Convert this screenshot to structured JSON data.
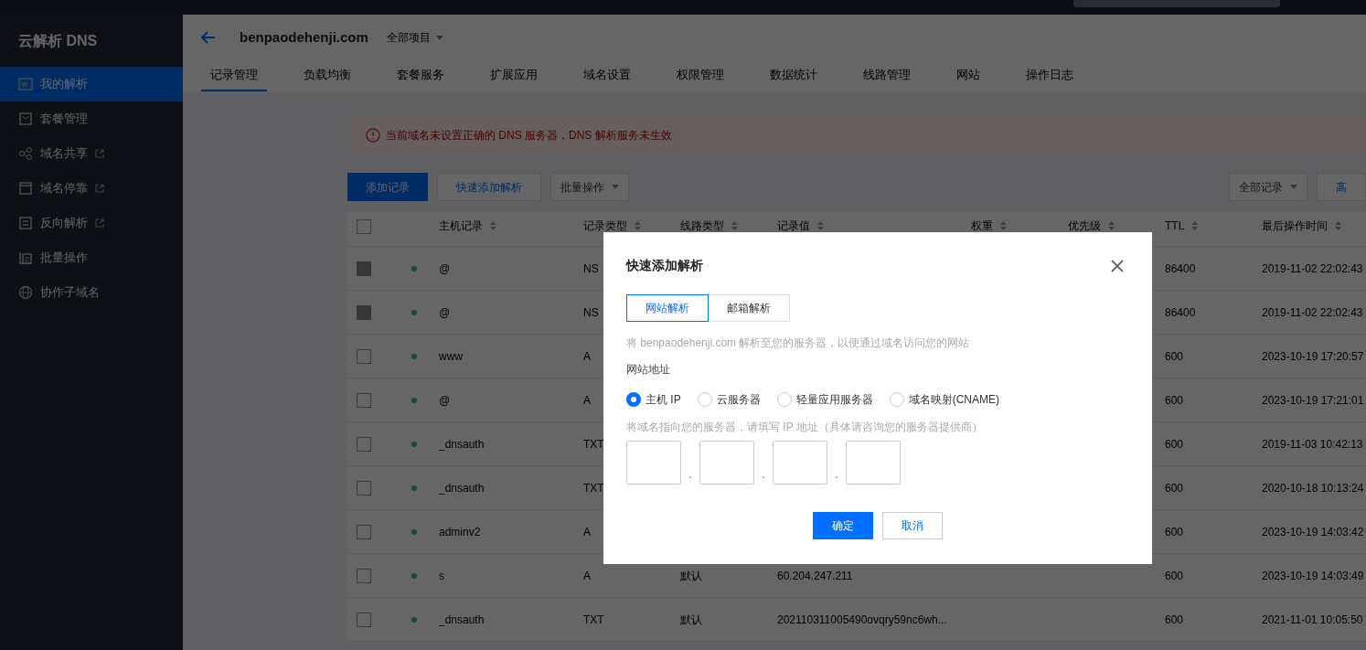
{
  "app": {
    "title": "云解析 DNS"
  },
  "sidebar": {
    "items": [
      {
        "label": "我的解析",
        "selected": true,
        "external": false
      },
      {
        "label": "套餐管理",
        "selected": false,
        "external": false
      },
      {
        "label": "域名共享",
        "selected": false,
        "external": true
      },
      {
        "label": "域名停靠",
        "selected": false,
        "external": true
      },
      {
        "label": "反向解析",
        "selected": false,
        "external": true
      },
      {
        "label": "批量操作",
        "selected": false,
        "external": false
      },
      {
        "label": "协作子域名",
        "selected": false,
        "external": false
      }
    ]
  },
  "header": {
    "domain": "benpaodehenji.com",
    "project": "全部项目"
  },
  "tabs": [
    {
      "label": "记录管理",
      "selected": true
    },
    {
      "label": "负载均衡",
      "selected": false
    },
    {
      "label": "套餐服务",
      "selected": false
    },
    {
      "label": "扩展应用",
      "selected": false
    },
    {
      "label": "域名设置",
      "selected": false
    },
    {
      "label": "权限管理",
      "selected": false
    },
    {
      "label": "数据统计",
      "selected": false
    },
    {
      "label": "线路管理",
      "selected": false
    },
    {
      "label": "网站",
      "selected": false
    },
    {
      "label": "操作日志",
      "selected": false
    }
  ],
  "alert": {
    "text": "当前域名未设置正确的 DNS 服务器，DNS 解析服务未生效"
  },
  "toolbar": {
    "left": [
      {
        "label": "添加记录",
        "kind": "primary"
      },
      {
        "label": "快速添加解析",
        "kind": "link"
      },
      {
        "label": "批量操作",
        "kind": "dropdown"
      }
    ],
    "right": [
      {
        "label": "全部记录",
        "kind": "dropdown"
      },
      {
        "label": "高",
        "kind": "link"
      }
    ]
  },
  "table": {
    "columns": [
      "主机记录",
      "记录类型",
      "线路类型",
      "记录值",
      "权重",
      "优先级",
      "TTL",
      "最后操作时间"
    ],
    "select_all": {
      "checked": false
    },
    "rows": [
      {
        "disabled": true,
        "host": "@",
        "type": "NS",
        "ttl": "86400",
        "time": "2019-11-02 22:02:43"
      },
      {
        "disabled": true,
        "host": "@",
        "type": "NS",
        "ttl": "86400",
        "time": "2019-11-02 22:02:43"
      },
      {
        "disabled": false,
        "host": "www",
        "type": "A",
        "ttl": "600",
        "time": "2023-10-19 17:20:57"
      },
      {
        "disabled": false,
        "host": "@",
        "type": "A",
        "ttl": "600",
        "time": "2023-10-19 17:21:01"
      },
      {
        "disabled": false,
        "host": "_dnsauth",
        "type": "TXT",
        "ttl": "600",
        "time": "2019-11-03 10:42:13"
      },
      {
        "disabled": false,
        "host": "_dnsauth",
        "type": "TXT",
        "ttl": "600",
        "time": "2020-10-18 10:13:24"
      },
      {
        "disabled": false,
        "host": "adminv2",
        "type": "A",
        "ttl": "600",
        "time": "2023-10-19 14:03:42"
      },
      {
        "disabled": false,
        "host": "s",
        "type": "A",
        "line": "默认",
        "value": "60.204.247.211",
        "ttl": "600",
        "time": "2023-10-19 14:03:49"
      },
      {
        "disabled": false,
        "host": "_dnsauth",
        "type": "TXT",
        "line": "默认",
        "value": "202110311005490ovqry59nc6wh...",
        "ttl": "600",
        "time": "2021-11-01 10:05:50"
      }
    ]
  },
  "dialog": {
    "title": "快速添加解析",
    "tabs": [
      {
        "label": "网站解析",
        "selected": true
      },
      {
        "label": "邮箱解析",
        "selected": false
      }
    ],
    "description": "将 benpaodehenji.com 解析至您的服务器，以便通过域名访问您的网站",
    "field_label": "网站地址",
    "options": [
      {
        "label": "主机 IP",
        "selected": true
      },
      {
        "label": "云服务器",
        "selected": false
      },
      {
        "label": "轻量应用服务器",
        "selected": false
      },
      {
        "label": "域名映射(CNAME)",
        "selected": false
      }
    ],
    "hint": "将域名指向您的服务器，请填写 IP 地址（具体请咨询您的服务器提供商）",
    "ip_separators": [
      ".",
      ".",
      "."
    ],
    "buttons": [
      {
        "label": "确定",
        "kind": "primary"
      },
      {
        "label": "取消",
        "kind": "secondary"
      }
    ]
  }
}
